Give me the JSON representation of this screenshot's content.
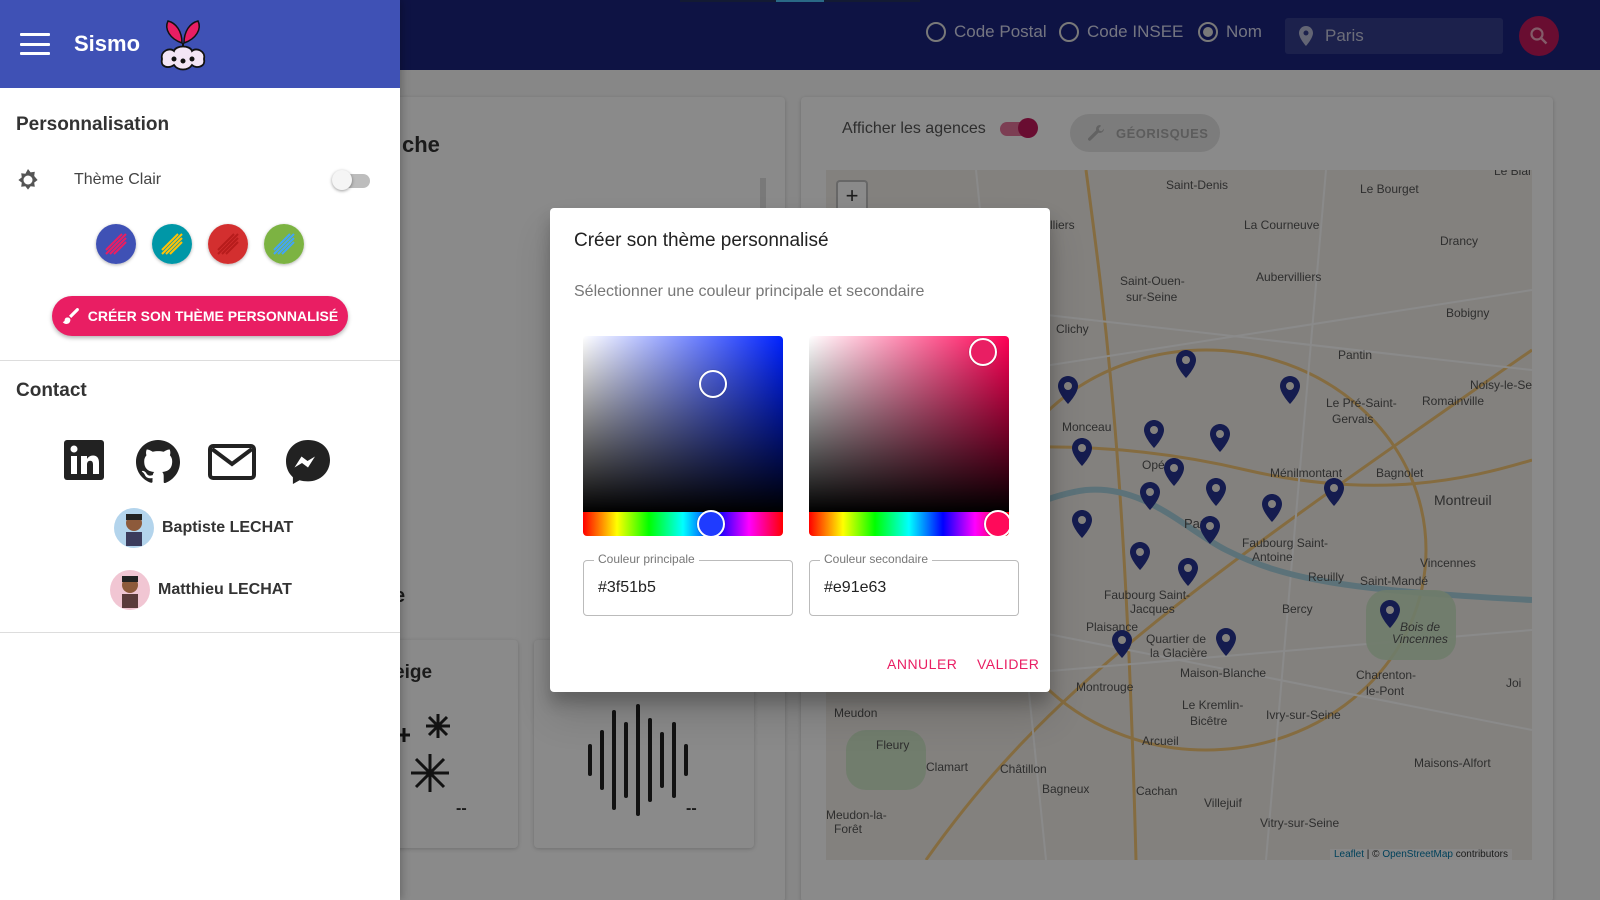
{
  "topbar": {
    "search_options": [
      {
        "label": "Code Postal",
        "checked": false
      },
      {
        "label": "Code INSEE",
        "checked": false
      },
      {
        "label": "Nom",
        "checked": true
      }
    ],
    "search_value": "Paris"
  },
  "main": {
    "left_title_fragment": "che",
    "left_subtitle_fragment": "e",
    "tile_label_fragment": "eige",
    "tile_value_1": "--",
    "tile_value_2": "--",
    "agences_label": "Afficher les agences",
    "georisques_label": "GÉORISQUES"
  },
  "map": {
    "zoom_in": "+",
    "attribution_leaflet": "Leaflet",
    "attribution_sep": " | © ",
    "attribution_osm": "OpenStreetMap",
    "attribution_tail": " contributors",
    "labels": [
      "Saint-Denis",
      "Le Bourget",
      "Le Blan",
      "La Courneuve",
      "Drancy",
      "Saint-Ouen-",
      "sur-Seine",
      "Aubervilliers",
      "Bobigny",
      "Clichy",
      "Pantin",
      "Noisy-le-Se",
      "Le Pré-Saint-",
      "Gervais",
      "Romainville",
      "Monceau",
      "Opéra",
      "Ménilmontant",
      "Bagnolet",
      "Montreuil",
      "Paris",
      "Faubourg Saint-",
      "Antoine",
      "Vincennes",
      "Reuilly",
      "Saint-Mandé",
      "Bercy",
      "Bois de",
      "Vincennes",
      "Quartier de",
      "la Glacière",
      "Maison-Blanche",
      "Charenton-",
      "le-Pont",
      "Montrouge",
      "Meudon",
      "Le Kremlin-",
      "Bicêtre",
      "Ivry-sur-Seine",
      "Fleury",
      "Arcueil",
      "Clamart",
      "Châtillon",
      "Maisons-Alfort",
      "Bagneux",
      "Cachan",
      "Villejuif",
      "Vitry-sur-Seine",
      "Meudon-la-",
      "Forêt",
      "Joi",
      "lliers",
      "Faubourg Saint-",
      "Jacques",
      "Plaisance"
    ]
  },
  "drawer": {
    "app_name": "Sismo",
    "personalisation_title": "Personnalisation",
    "theme_label": "Thème Clair",
    "theme_swatches": [
      {
        "primary": "#3f51b5",
        "secondary": "#e91e63"
      },
      {
        "primary": "#0097a7",
        "secondary": "#ffc107"
      },
      {
        "primary": "#d32f2f",
        "secondary": "#b71c1c"
      },
      {
        "primary": "#7cb342",
        "secondary": "#42a5f5"
      }
    ],
    "create_button": "CRÉER SON THÈME PERSONNALISÉ",
    "contact_title": "Contact",
    "contacts": [
      "Baptiste LECHAT",
      "Matthieu LECHAT"
    ]
  },
  "dialog": {
    "title": "Créer son thème personnalisé",
    "description": "Sélectionner une couleur principale et secondaire",
    "primary_label": "Couleur principale",
    "primary_value": "#3f51b5",
    "secondary_label": "Couleur secondaire",
    "secondary_value": "#e91e63",
    "cancel": "ANNULER",
    "confirm": "VALIDER"
  },
  "colors": {
    "primary": "#3f51b5",
    "secondary": "#e91e63",
    "topbar": "#1a237e"
  }
}
